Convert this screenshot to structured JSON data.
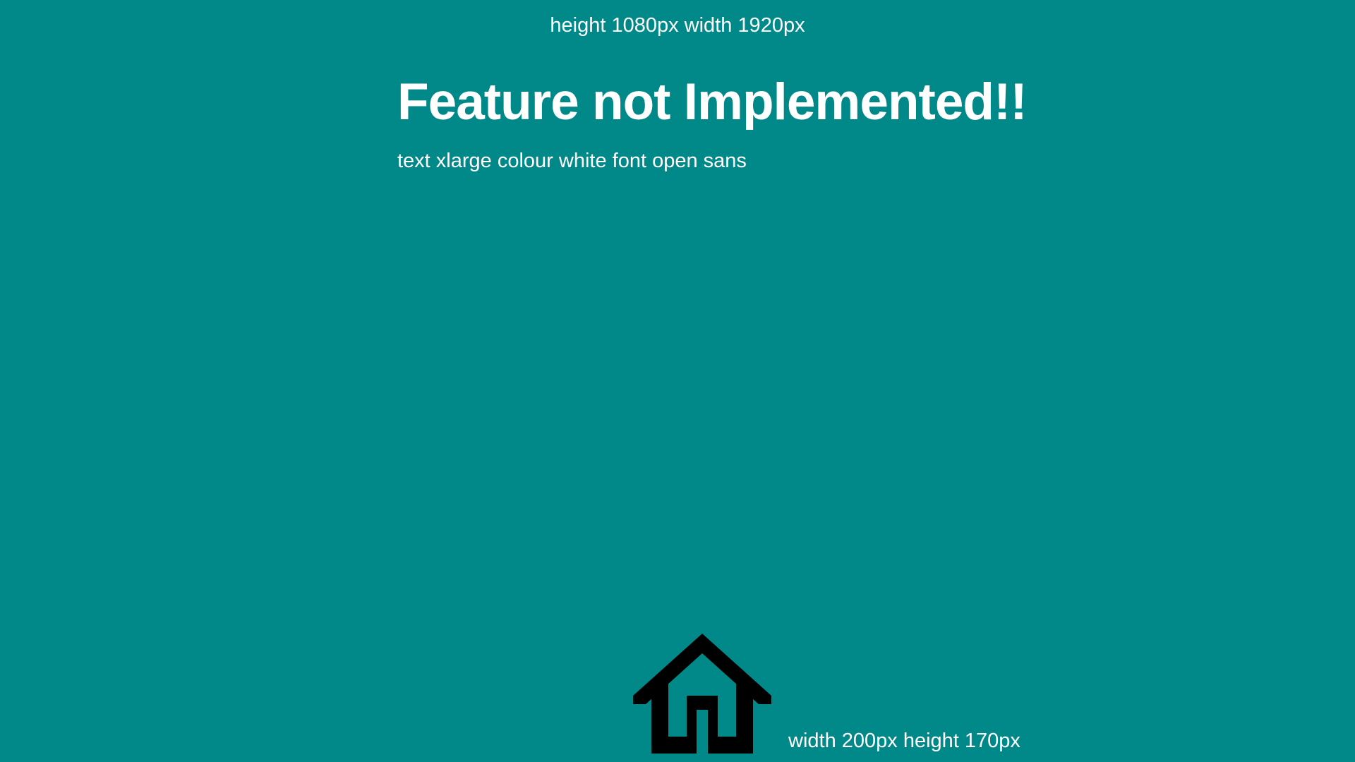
{
  "page": {
    "background_color": "#018989",
    "text_color": "#ffffff",
    "size_note": "height 1080px width 1920px"
  },
  "message": {
    "title": "Feature not Implemented!!",
    "subtitle": "text xlarge colour white font open sans"
  },
  "home": {
    "icon": "home-icon",
    "icon_color": "#000000",
    "size_note": "width 200px height 170px"
  }
}
